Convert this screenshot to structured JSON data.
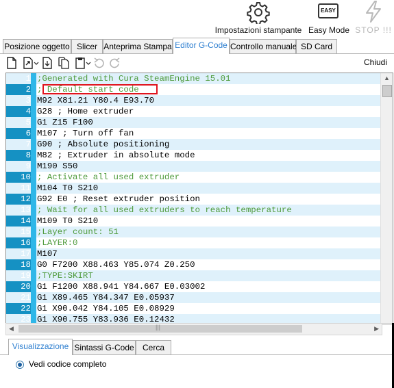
{
  "toolbar_top": {
    "printer_settings_label": "Impostazioni stampante",
    "easy_mode_label": "Easy Mode",
    "easy_icon_text": "EASY",
    "stop_label": "STOP !!!"
  },
  "tabs": [
    {
      "label": "Posizione oggetto"
    },
    {
      "label": "Slicer"
    },
    {
      "label": "Anteprima Stampa"
    },
    {
      "label": "Editor G-Code"
    },
    {
      "label": "Controllo manuale"
    },
    {
      "label": "SD Card"
    }
  ],
  "editor_toolbar": {
    "close_label": "Chiudi"
  },
  "gcode_lines": [
    {
      "n": "1",
      "text": ";Generated with Cura SteamEngine 15.01",
      "comment": true
    },
    {
      "n": "2",
      "text": "; Default start code",
      "comment": true
    },
    {
      "n": "3",
      "text": "M92 X81.21 Y80.4 E93.70",
      "comment": false
    },
    {
      "n": "4",
      "text": "G28 ; Home extruder",
      "comment": false
    },
    {
      "n": "5",
      "text": "G1 Z15 F100",
      "comment": false
    },
    {
      "n": "6",
      "text": "M107 ; Turn off fan",
      "comment": false
    },
    {
      "n": "7",
      "text": "G90 ; Absolute positioning",
      "comment": false
    },
    {
      "n": "8",
      "text": "M82 ; Extruder in absolute mode",
      "comment": false
    },
    {
      "n": "9",
      "text": "M190 S50",
      "comment": false
    },
    {
      "n": "10",
      "text": "; Activate all used extruder",
      "comment": true
    },
    {
      "n": "11",
      "text": "M104 T0 S210",
      "comment": false
    },
    {
      "n": "12",
      "text": "G92 E0 ; Reset extruder position",
      "comment": false
    },
    {
      "n": "13",
      "text": "; Wait for all used extruders to reach temperature",
      "comment": true
    },
    {
      "n": "14",
      "text": "M109 T0 S210",
      "comment": false
    },
    {
      "n": "15",
      "text": ";Layer count: 51",
      "comment": true
    },
    {
      "n": "16",
      "text": ";LAYER:0",
      "comment": true
    },
    {
      "n": "17",
      "text": "M107",
      "comment": false
    },
    {
      "n": "18",
      "text": "G0 F7200 X88.463 Y85.074 Z0.250",
      "comment": false
    },
    {
      "n": "19",
      "text": ";TYPE:SKIRT",
      "comment": true
    },
    {
      "n": "20",
      "text": "G1 F1200 X88.941 Y84.667 E0.03002",
      "comment": false
    },
    {
      "n": "21",
      "text": "G1 X89.465 Y84.347 E0.05937",
      "comment": false
    },
    {
      "n": "22",
      "text": "G1 X90.042 Y84.105 E0.08929",
      "comment": false
    },
    {
      "n": "23",
      "text": "G1 X90.755 Y83.936 E0.12432",
      "comment": false
    }
  ],
  "bottom_tabs": [
    {
      "label": "Visualizzazione"
    },
    {
      "label": "Sintassi G-Code"
    },
    {
      "label": "Cerca"
    }
  ],
  "view_option": {
    "label": "Vedi codice completo"
  },
  "colors": {
    "accent": "#2e7fd0",
    "gutter": "#1591c3",
    "comment": "#4d9a3a",
    "highlight": "#e0141e"
  }
}
